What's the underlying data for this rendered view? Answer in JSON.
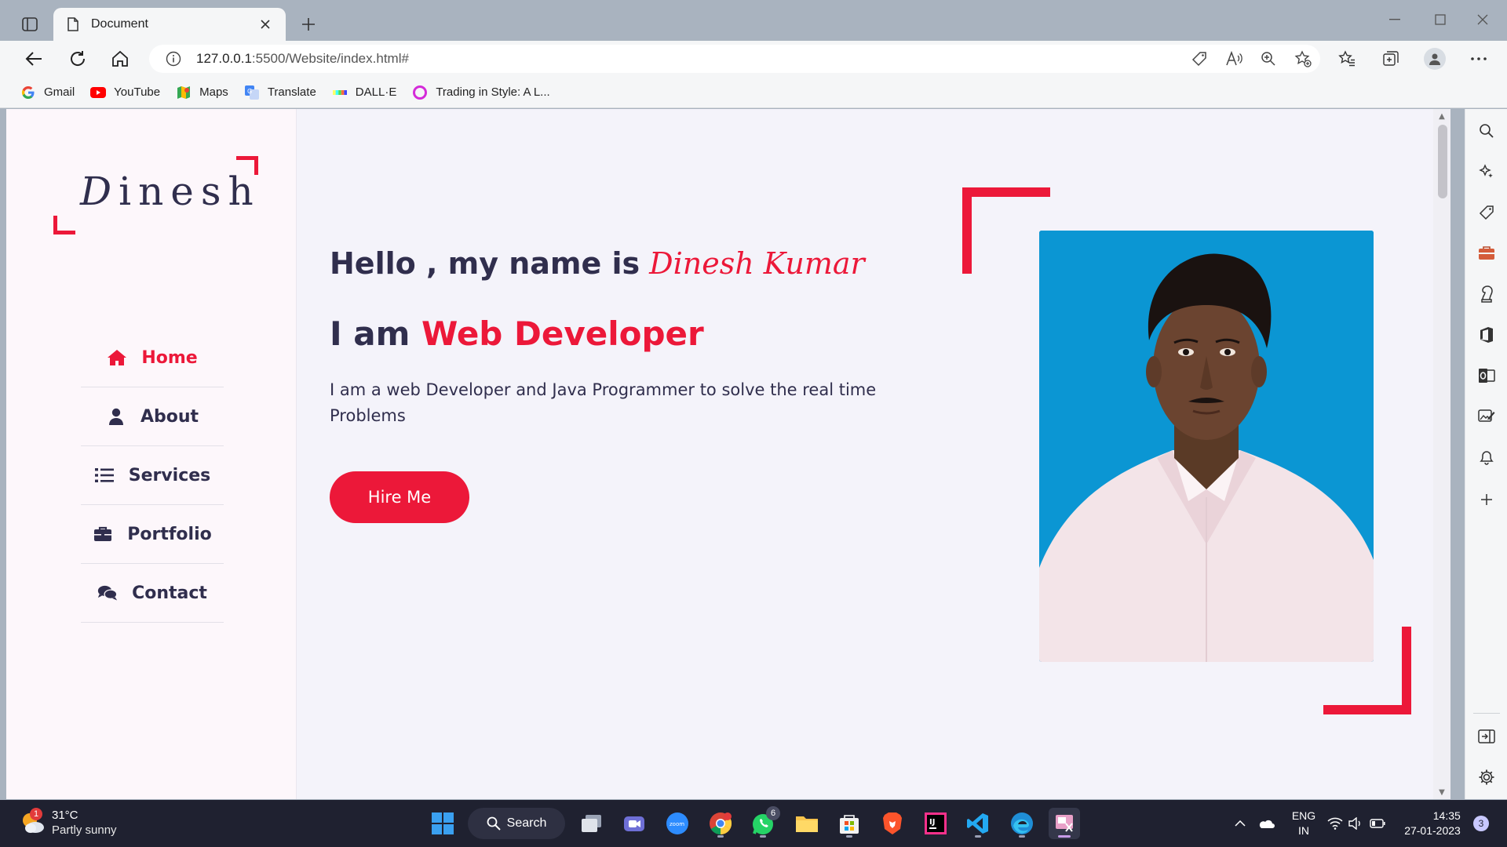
{
  "browser": {
    "tab_title": "Document",
    "url_host": "127.0.0.1",
    "url_rest": ":5500/Website/index.html#",
    "bookmarks": [
      {
        "label": "Gmail",
        "icon": "google-icon"
      },
      {
        "label": "YouTube",
        "icon": "youtube-icon"
      },
      {
        "label": "Maps",
        "icon": "maps-icon"
      },
      {
        "label": "Translate",
        "icon": "translate-icon"
      },
      {
        "label": "DALL·E",
        "icon": "dalle-icon"
      },
      {
        "label": "Trading in Style: A L...",
        "icon": "circle-icon"
      }
    ]
  },
  "site": {
    "logo_first": "D",
    "logo_rest": "inesh",
    "nav": [
      {
        "label": "Home",
        "icon": "home-icon",
        "active": true
      },
      {
        "label": "About",
        "icon": "user-icon",
        "active": false
      },
      {
        "label": "Services",
        "icon": "list-icon",
        "active": false
      },
      {
        "label": "Portfolio",
        "icon": "briefcase-icon",
        "active": false
      },
      {
        "label": "Contact",
        "icon": "comments-icon",
        "active": false
      }
    ],
    "hello_prefix": "Hello , my name is",
    "hello_name": "Dinesh Kumar",
    "iam_prefix": "I am",
    "iam_role": "Web Developer",
    "description": "I am a web Developer and Java Programmer to solve the real time Problems",
    "hire_label": "Hire Me",
    "accent_color": "#ec1839",
    "dark_color": "#302e4d"
  },
  "taskbar": {
    "weather_temp": "31°C",
    "weather_condition": "Partly sunny",
    "weather_badge": "1",
    "search_label": "Search",
    "whatsapp_badge": "6",
    "lang_line1": "ENG",
    "lang_line2": "IN",
    "time": "14:35",
    "date": "27-01-2023",
    "notification_count": "3"
  }
}
